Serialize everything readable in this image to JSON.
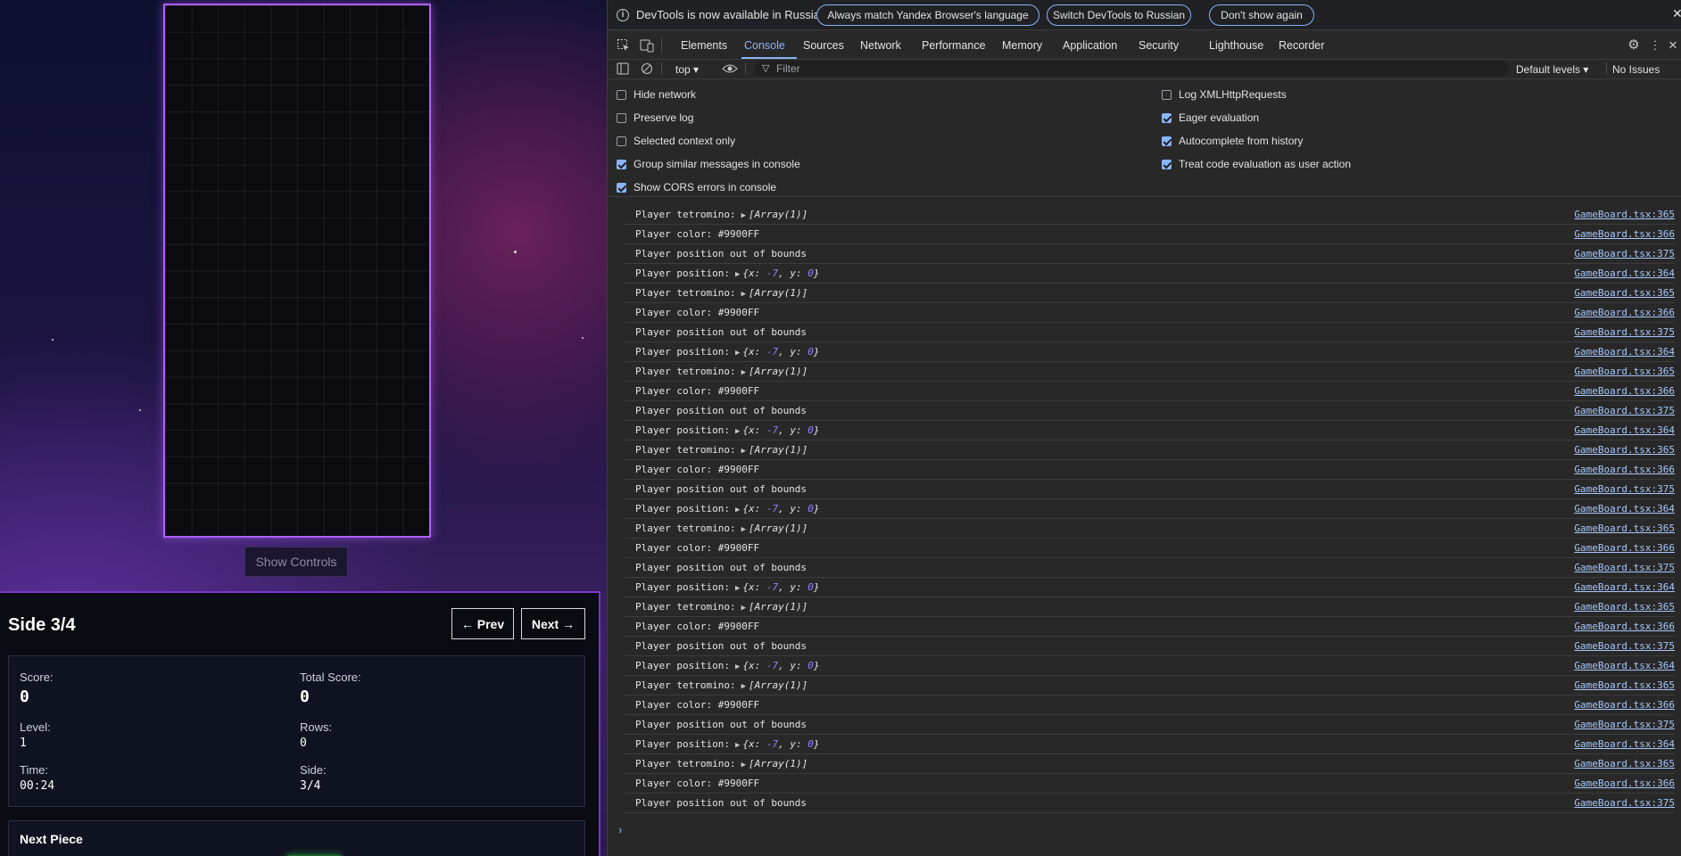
{
  "game": {
    "show_controls": "Show Controls",
    "side_title": "Side 3/4",
    "prev_label": "← Prev",
    "next_label": "Next →",
    "stats": {
      "score_label": "Score:",
      "score": "0",
      "total_label": "Total Score:",
      "total": "0",
      "level_label": "Level:",
      "level": "1",
      "rows_label": "Rows:",
      "rows": "0",
      "time_label": "Time:",
      "time": "00:24",
      "side_label": "Side:",
      "side": "3/4"
    },
    "next_piece_title": "Next Piece",
    "colors": {
      "board_border": "#b060ff",
      "panel_border": "#7b35c9",
      "next_piece": "#2e9a3e"
    }
  },
  "devtools": {
    "infobar": {
      "text": "DevTools is now available in Russian!",
      "btn_match": "Always match Yandex Browser's language",
      "btn_switch": "Switch DevTools to Russian",
      "btn_dont": "Don't show again",
      "close": "✕"
    },
    "tabs": [
      "Elements",
      "Console",
      "Sources",
      "Network",
      "Performance",
      "Memory",
      "Application",
      "Security",
      "Lighthouse",
      "Recorder"
    ],
    "toolbar": {
      "context": "top ▾",
      "filter_placeholder": "Filter",
      "levels": "Default levels ▾",
      "issues": "No Issues"
    },
    "settings": {
      "hide_network": "Hide network",
      "preserve_log": "Preserve log",
      "selected_context": "Selected context only",
      "group_similar": "Group similar messages in console",
      "show_cors": "Show CORS errors in console",
      "log_xhr": "Log XMLHttpRequests",
      "eager_eval": "Eager evaluation",
      "autocomplete": "Autocomplete from history",
      "treat_code": "Treat code evaluation as user action"
    },
    "console": {
      "msg_tetromino": "Player tetromino:",
      "tetromino_value": "[Array(1)]",
      "msg_color": "Player color: #9900FF",
      "msg_oob": "Player position out of bounds",
      "msg_position": "Player position:",
      "pos_x_key": "x:",
      "pos_x": "-7",
      "pos_y_key": "y:",
      "pos_y": "0",
      "src_364": "GameBoard.tsx:364",
      "src_365": "GameBoard.tsx:365",
      "src_366": "GameBoard.tsx:366",
      "src_375": "GameBoard.tsx:375",
      "prompt": "›"
    }
  }
}
